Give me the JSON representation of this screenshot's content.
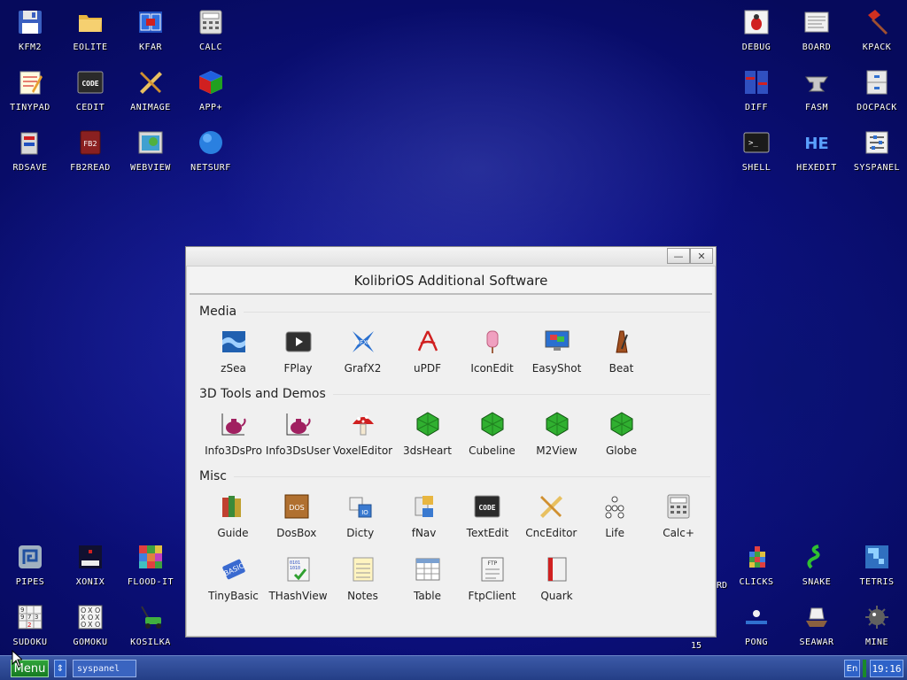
{
  "desktop": {
    "icons": [
      {
        "label": "KFM2",
        "icon": "floppy-icon"
      },
      {
        "label": "EOLITE",
        "icon": "folder-icon"
      },
      {
        "label": "KFAR",
        "icon": "kfar-icon"
      },
      {
        "label": "CALC",
        "icon": "calculator-icon"
      },
      {
        "label": "TINYPAD",
        "icon": "notepad-icon"
      },
      {
        "label": "CEDIT",
        "icon": "code-icon"
      },
      {
        "label": "ANIMAGE",
        "icon": "pencil-ruler-icon"
      },
      {
        "label": "APP+",
        "icon": "cube-icon"
      },
      {
        "label": "RDSAVE",
        "icon": "rdsave-icon"
      },
      {
        "label": "FB2READ",
        "icon": "book-icon"
      },
      {
        "label": "WEBVIEW",
        "icon": "webview-icon"
      },
      {
        "label": "NETSURF",
        "icon": "globe-icon"
      },
      {
        "label": "DEBUG",
        "icon": "bug-icon"
      },
      {
        "label": "BOARD",
        "icon": "board-icon"
      },
      {
        "label": "KPACK",
        "icon": "hammer-icon"
      },
      {
        "label": "DIFF",
        "icon": "diff-icon"
      },
      {
        "label": "FASM",
        "icon": "anvil-icon"
      },
      {
        "label": "DOCPACK",
        "icon": "cabinet-icon"
      },
      {
        "label": "SHELL",
        "icon": "terminal-icon"
      },
      {
        "label": "HEXEDIT",
        "icon": "hex-icon"
      },
      {
        "label": "SYSPANEL",
        "icon": "sliders-icon"
      },
      {
        "label": "PIPES",
        "icon": "pipes-icon"
      },
      {
        "label": "XONIX",
        "icon": "xonix-icon"
      },
      {
        "label": "FLOOD-IT",
        "icon": "flood-icon"
      },
      {
        "label": "CLICKS",
        "icon": "clicks-icon"
      },
      {
        "label": "SNAKE",
        "icon": "snake-icon"
      },
      {
        "label": "TETRIS",
        "icon": "tetris-icon"
      },
      {
        "label": "SUDOKU",
        "icon": "sudoku-icon"
      },
      {
        "label": "GOMOKU",
        "icon": "gomoku-icon"
      },
      {
        "label": "KOSILKA",
        "icon": "mower-icon"
      },
      {
        "label": "PONG",
        "icon": "pong-icon"
      },
      {
        "label": "SEAWAR",
        "icon": "ship-icon"
      },
      {
        "label": "MINE",
        "icon": "mine-icon"
      }
    ],
    "partial_labels": [
      "RD",
      "15"
    ]
  },
  "window": {
    "title": "KolibriOS Additional Software",
    "minimize_label": "—",
    "close_label": "✕",
    "sections": [
      {
        "title": "Media",
        "apps": [
          "zSea",
          "FPlay",
          "GrafX2",
          "uPDF",
          "IconEdit",
          "EasyShot",
          "Beat"
        ]
      },
      {
        "title": "3D Tools and Demos",
        "apps": [
          "Info3DsPro",
          "Info3DsUser",
          "VoxelEditor",
          "3dsHeart",
          "Cubeline",
          "M2View",
          "Globe"
        ]
      },
      {
        "title": "Misc",
        "apps": [
          "Guide",
          "DosBox",
          "Dicty",
          "fNav",
          "TextEdit",
          "CncEditor",
          "Life",
          "Calc+",
          "TinyBasic",
          "THashView",
          "Notes",
          "Table",
          "FtpClient",
          "Quark"
        ]
      }
    ]
  },
  "taskbar": {
    "menu_label": "Menu",
    "arrow_label": "⇕",
    "task_label": "syspanel",
    "lang_label": "En",
    "clock": "19:16"
  },
  "colors": {
    "desktop": "#0d1185",
    "taskbar": "#2e4e9c",
    "menu_button": "#1f8f2c",
    "window_bg": "#f0f0f0"
  }
}
